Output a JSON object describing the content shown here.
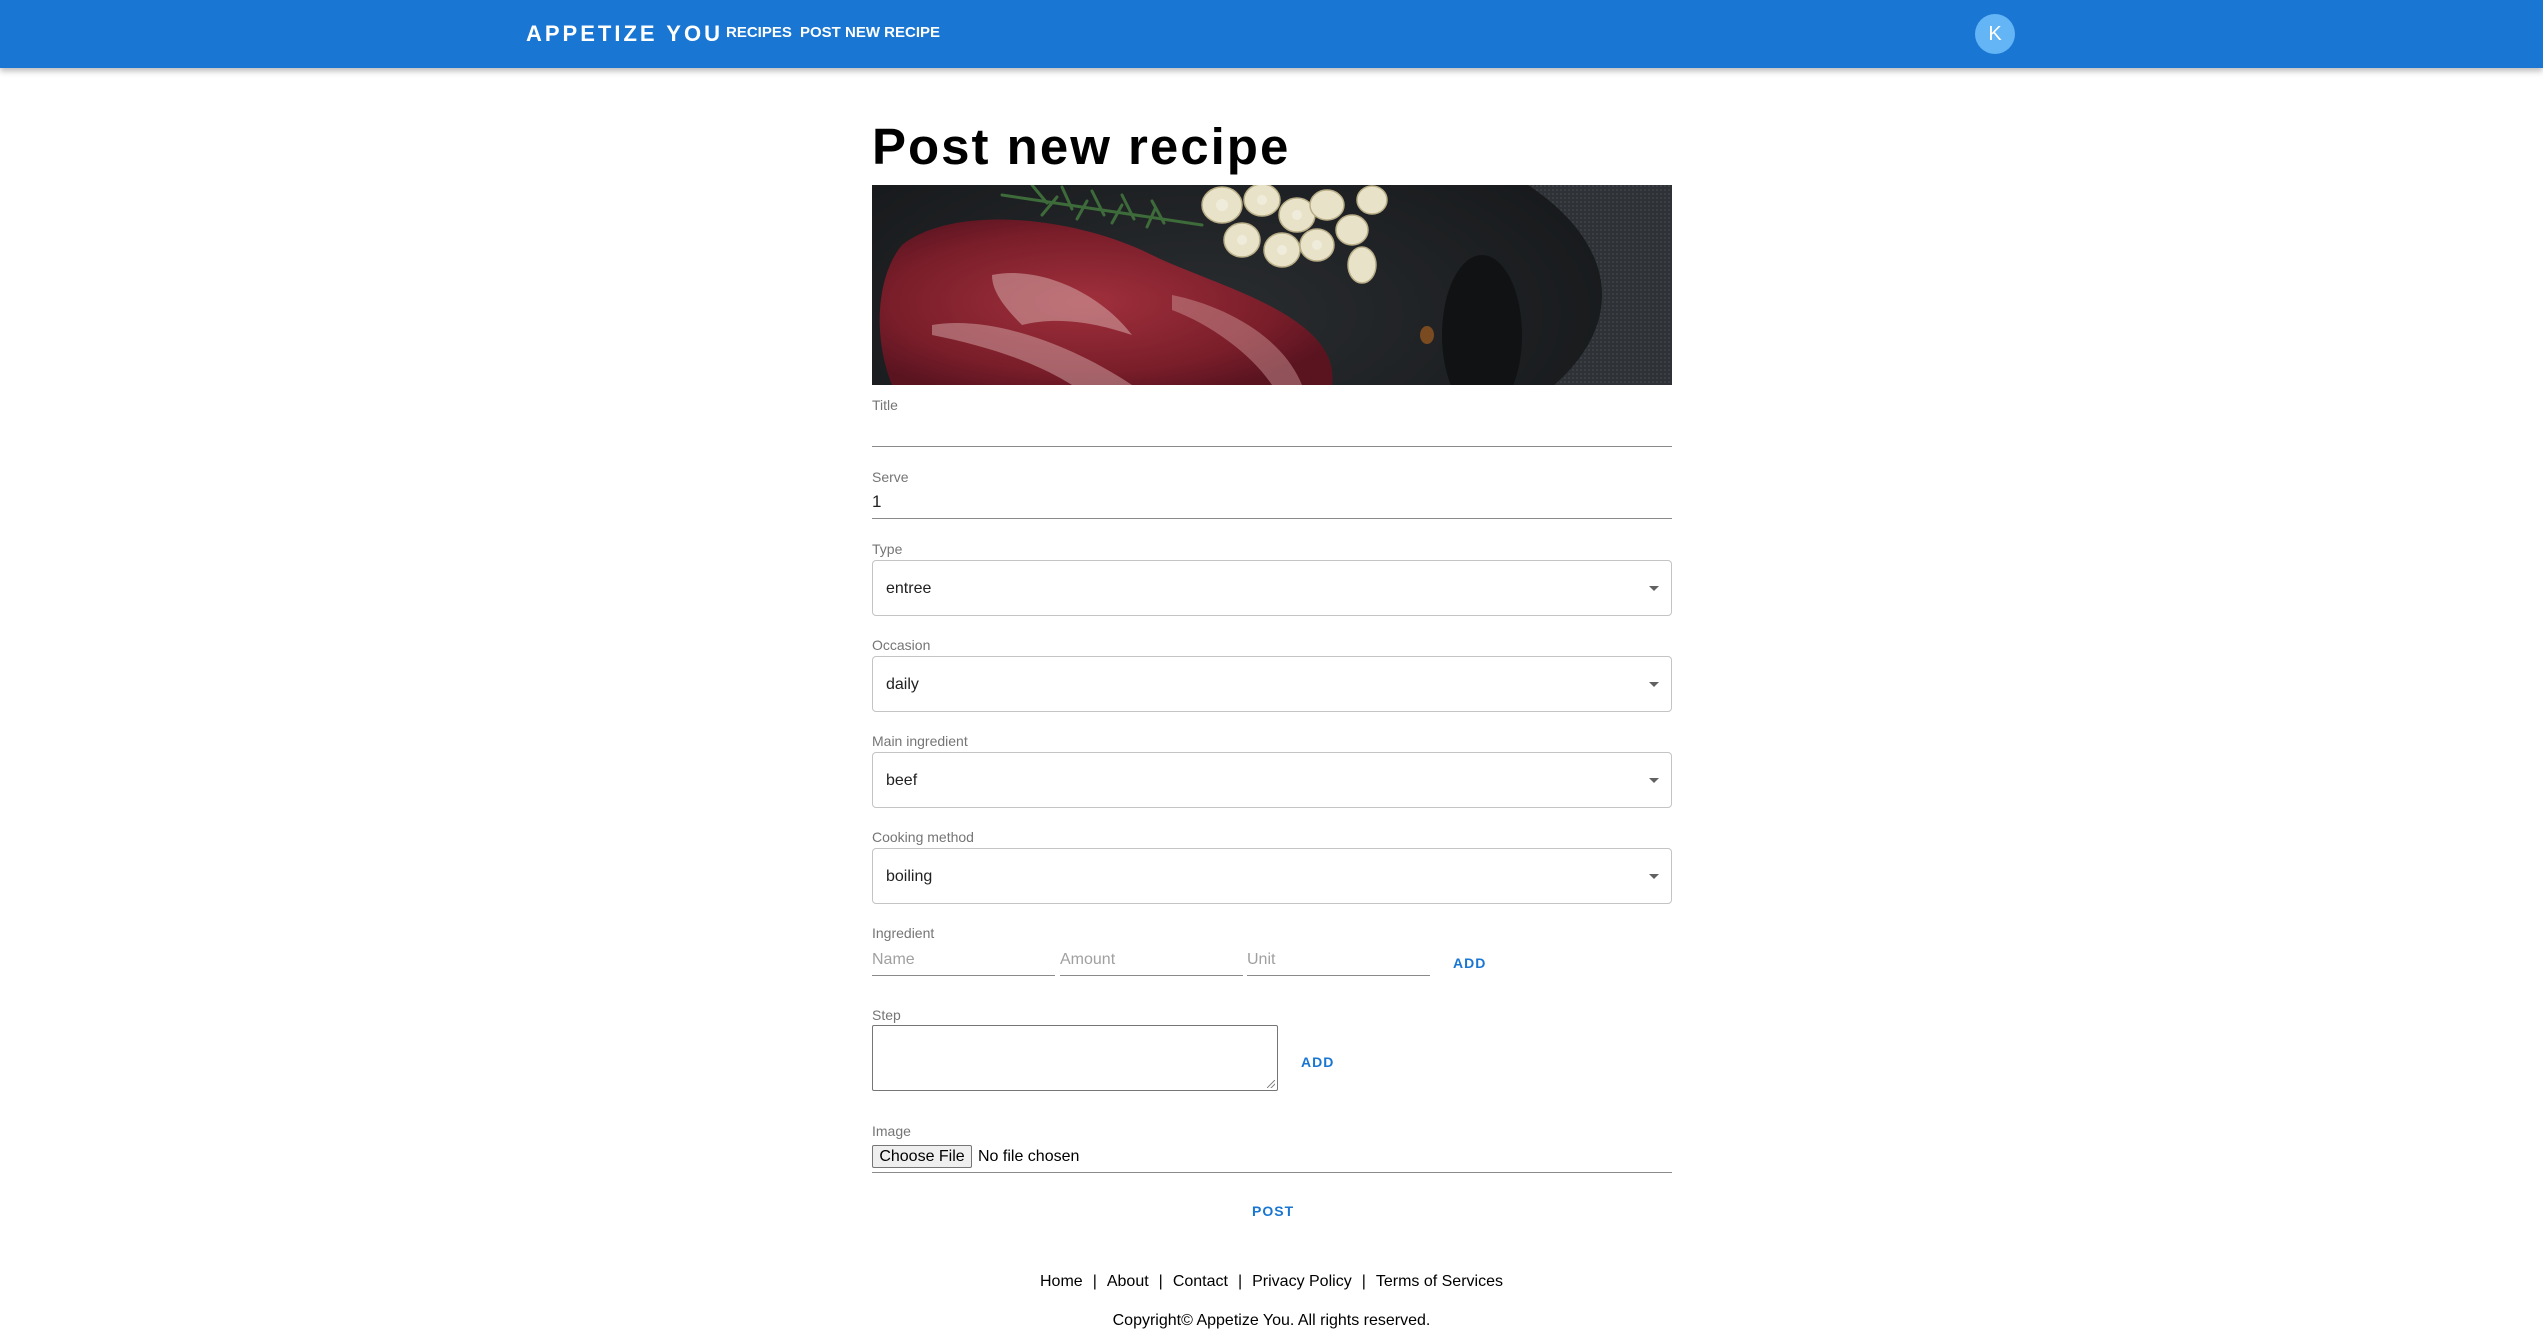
{
  "header": {
    "brand": "APPETIZE YOU",
    "nav": [
      "RECIPES",
      "POST NEW RECIPE"
    ],
    "avatar_initial": "K",
    "bar_color": "#1976d2"
  },
  "page_title": "Post new recipe",
  "hero_image": {
    "icon": "recipe-cover-photo",
    "subject": "raw steak with garlic and rosemary in a pan"
  },
  "form": {
    "title": {
      "label": "Title",
      "value": ""
    },
    "serve": {
      "label": "Serve",
      "value": "1"
    },
    "type": {
      "label": "Type",
      "value": "entree"
    },
    "occasion": {
      "label": "Occasion",
      "value": "daily"
    },
    "main_ingredient": {
      "label": "Main ingredient",
      "value": "beef"
    },
    "cooking_method": {
      "label": "Cooking method",
      "value": "boiling"
    },
    "ingredient": {
      "label": "Ingredient",
      "name_placeholder": "Name",
      "amount_placeholder": "Amount",
      "unit_placeholder": "Unit",
      "add_label": "ADD"
    },
    "step": {
      "label": "Step",
      "value": "",
      "add_label": "ADD"
    },
    "image": {
      "label": "Image",
      "button_label": "Choose File",
      "status": "No file chosen"
    },
    "post_label": "POST"
  },
  "footer": {
    "links": [
      "Home",
      "About",
      "Contact",
      "Privacy Policy",
      "Terms of Services"
    ],
    "separator": "|",
    "copyright": "Copyright© Appetize You. All rights reserved."
  }
}
